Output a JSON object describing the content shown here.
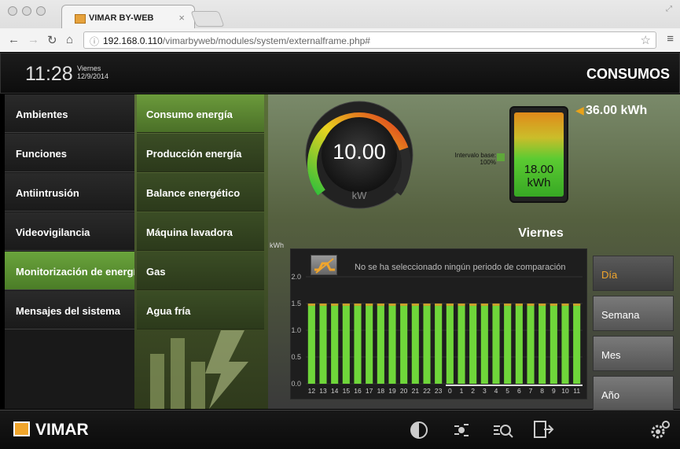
{
  "browser": {
    "tab_title": "VIMAR BY-WEB",
    "tab_close": "×",
    "url_host": "192.168.0.110",
    "url_path": "/vimarbyweb/modules/system/externalframe.php#"
  },
  "header": {
    "time": "11:28",
    "weekday": "Viernes",
    "date": "12/9/2014",
    "title": "CONSUMOS"
  },
  "menu_primary": [
    {
      "label": "Ambientes"
    },
    {
      "label": "Funciones"
    },
    {
      "label": "Antiintrusión"
    },
    {
      "label": "Videovigilancia"
    },
    {
      "label": "Monitorización de energía"
    },
    {
      "label": "Mensajes del sistema"
    }
  ],
  "menu_secondary": [
    {
      "label": "Consumo energía"
    },
    {
      "label": "Producción energía"
    },
    {
      "label": "Balance energético"
    },
    {
      "label": "Máquina lavadora"
    },
    {
      "label": "Gas"
    },
    {
      "label": "Agua fría"
    }
  ],
  "gauge": {
    "value": "10.00",
    "unit": "kW",
    "fill_fraction": 0.78
  },
  "battery": {
    "value": "18.00",
    "unit": "kWh",
    "max_label": "36.00 kWh"
  },
  "interval": {
    "line1": "Intervalo base:",
    "line2": "100%"
  },
  "chart": {
    "day_label": "Viernes",
    "unit": "kWh",
    "compare_message": "No se ha seleccionado ningún periodo de comparación"
  },
  "chart_data": {
    "type": "bar",
    "title": "Viernes",
    "ylabel": "kWh",
    "xlabel": "",
    "ylim": [
      0,
      2.0
    ],
    "yticks": [
      "0.0",
      "0.5",
      "1.0",
      "1.5",
      "2.0"
    ],
    "categories": [
      "12",
      "13",
      "14",
      "15",
      "16",
      "17",
      "18",
      "19",
      "20",
      "21",
      "22",
      "23",
      "0",
      "1",
      "2",
      "3",
      "4",
      "5",
      "6",
      "7",
      "8",
      "9",
      "10",
      "11"
    ],
    "values": [
      1.5,
      1.5,
      1.5,
      1.5,
      1.5,
      1.5,
      1.5,
      1.5,
      1.5,
      1.5,
      1.5,
      1.5,
      1.5,
      1.5,
      1.5,
      1.5,
      1.5,
      1.5,
      1.5,
      1.5,
      1.5,
      1.5,
      1.5,
      1.5
    ],
    "bar_color": "#6fd63a",
    "grid": true
  },
  "period_buttons": [
    {
      "label": "Día",
      "active": true
    },
    {
      "label": "Semana",
      "active": false
    },
    {
      "label": "Mes",
      "active": false
    },
    {
      "label": "Año",
      "active": false
    }
  ],
  "footer": {
    "brand": "VIMAR",
    "icons": [
      "contrast-icon",
      "scenario-icon",
      "energy-search-icon",
      "export-icon",
      "settings-icon"
    ]
  },
  "colors": {
    "accent": "#f0a52c",
    "green": "#6fd63a",
    "menu_active": "#5a9a32"
  }
}
